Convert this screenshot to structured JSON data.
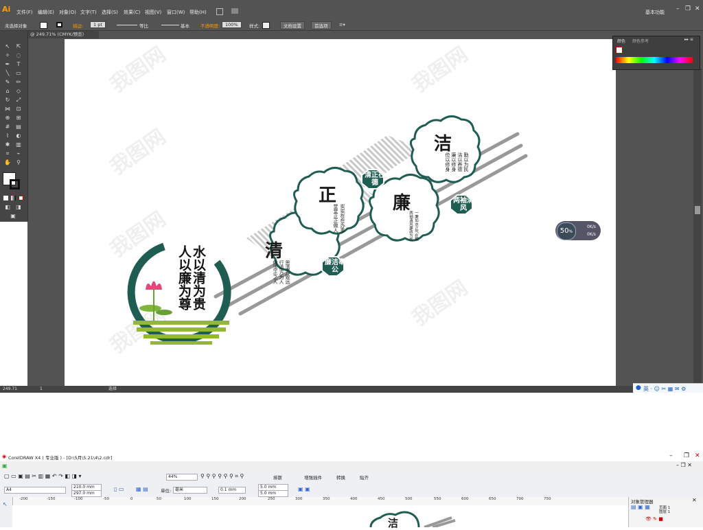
{
  "illustrator": {
    "logo": "Ai",
    "menu": [
      "文件(F)",
      "编辑(E)",
      "对象(O)",
      "文字(T)",
      "选择(S)",
      "效果(C)",
      "视图(V)",
      "窗口(W)",
      "帮助(H)"
    ],
    "workspace_label": "基本功能",
    "control": {
      "selection": "未选择对象",
      "stroke_label": "描边:",
      "stroke_value": "1 pt",
      "profile_uniform": "等比",
      "brush_basic": "基本",
      "opacity_label": "不透明度:",
      "opacity_value": "100%",
      "style_label": "样式:",
      "doc_setup": "文档设置",
      "preferences": "首选项"
    },
    "doc_tab": "@ 249.71% (CMYK/预览)",
    "color_panel_tabs": [
      "颜色",
      "颜色参考"
    ],
    "status": {
      "zoom": "249.71",
      "page": "1",
      "tool": "选择"
    },
    "perf_meter": {
      "value": "50",
      "unit": "%",
      "up": "0",
      "down": "0",
      "rate": "K/s"
    }
  },
  "artwork": {
    "poem": [
      "水以清为贵",
      "人以廉为尊"
    ],
    "medallions": [
      {
        "char": "清",
        "text": [
          "思清方致远",
          "行清方为人",
          "做清正之人"
        ]
      },
      {
        "char": "正",
        "text": [
          "实实在在办事",
          "堂堂正正做人"
        ]
      },
      {
        "char": "廉",
        "text": [
          "一廉如水正气在胸",
          "两袖清风廉政为民"
        ]
      },
      {
        "char": "洁",
        "text": [
          "勤以为民",
          "洁以养德",
          "廉以修身",
          "俭以修身"
        ]
      }
    ],
    "badges": [
      "廉洁奉公",
      "清正在德",
      "两袖清风"
    ],
    "watermark": "我图网"
  },
  "coreldraw": {
    "title": "CorelDRAW X4 ( 专业版 ) - [D:\\5月\\5.21\\4\\2.cdr]",
    "zoom": "44%",
    "align_label": "排斯",
    "plugin_label": "增强插件",
    "convert_label": "转换",
    "paste_label": "贴齐",
    "paper": "A4",
    "width": "210.0 mm",
    "height": "297.0 mm",
    "units_label": "单位:",
    "units": "毫米",
    "nudge": "0.1 mm",
    "dup_x": "5.0 mm",
    "dup_y": "5.0 mm",
    "ruler": [
      "-200",
      "-150",
      "-100",
      "-50",
      "0",
      "50",
      "100",
      "150",
      "200",
      "250",
      "300",
      "350",
      "400",
      "450",
      "500",
      "550",
      "600",
      "650",
      "700",
      "750"
    ],
    "obj_manager": {
      "title": "对象管理器",
      "page": "页面 1",
      "layer": "图层 1"
    },
    "canvas_char": "洁"
  }
}
